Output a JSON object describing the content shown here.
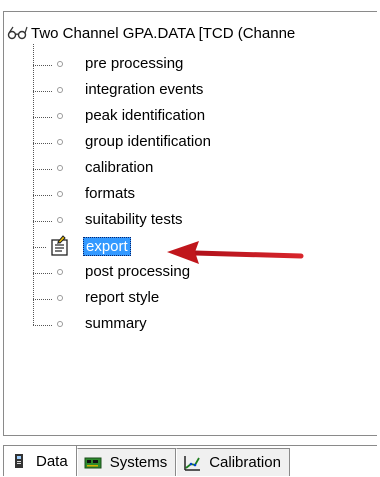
{
  "root": {
    "label": "Two Channel GPA.DATA [TCD  (Channe",
    "icon": "glasses-icon"
  },
  "tree": {
    "items": [
      {
        "label": "pre processing",
        "selected": false
      },
      {
        "label": "integration events",
        "selected": false
      },
      {
        "label": "peak identification",
        "selected": false
      },
      {
        "label": "group identification",
        "selected": false
      },
      {
        "label": "calibration",
        "selected": false
      },
      {
        "label": "formats",
        "selected": false
      },
      {
        "label": "suitability tests",
        "selected": false
      },
      {
        "label": "export",
        "selected": true,
        "icon": "export-document-icon"
      },
      {
        "label": "post processing",
        "selected": false
      },
      {
        "label": "report style",
        "selected": false
      },
      {
        "label": "summary",
        "selected": false
      }
    ]
  },
  "tabs": [
    {
      "label": "Data",
      "icon": "data-icon",
      "active": true
    },
    {
      "label": "Systems",
      "icon": "systems-board-icon",
      "active": false
    },
    {
      "label": "Calibration",
      "icon": "calibration-chart-icon",
      "active": false
    }
  ],
  "colors": {
    "selection": "#3399ff",
    "arrow": "#c0161c"
  }
}
